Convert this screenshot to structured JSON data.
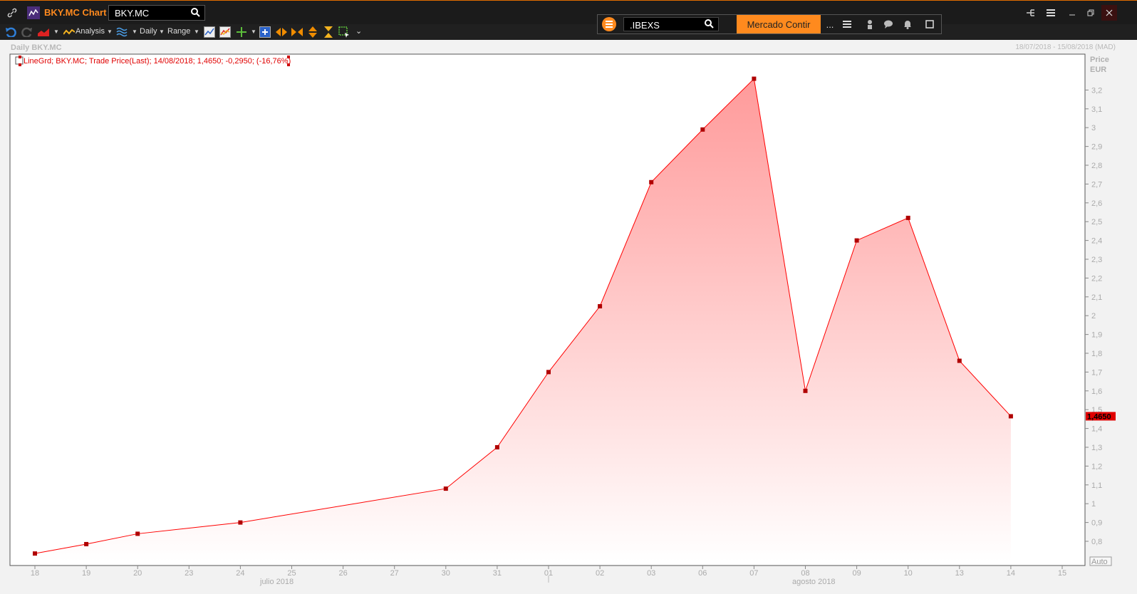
{
  "app": {
    "title": "BKY.MC Chart",
    "ric_value": "BKY.MC"
  },
  "float_panel": {
    "symbol_value": ".IBEXS",
    "mercado_label": "Mercado Contir",
    "more_label": "..."
  },
  "toolbar": {
    "analysis_label": "Analysis",
    "interval_label": "Daily",
    "range_label": "Range"
  },
  "chart_header": {
    "title": "Daily BKY.MC",
    "date_range": "18/07/2018 - 15/08/2018 (MAD)"
  },
  "legend": {
    "text": "LineGrd; BKY.MC; Trade Price(Last); 14/08/2018; 1,4650; -0,2950; (-16,76%)"
  },
  "axis": {
    "ylabel_line1": "Price",
    "ylabel_line2": "EUR",
    "auto_label": "Auto",
    "last_value_label": "1,4650",
    "month1_label": "julio 2018",
    "month2_label": "agosto 2018"
  },
  "colors": {
    "accent": "#ff8a1e",
    "series": "#ff0000",
    "marker": "#b00000"
  },
  "chart_data": {
    "type": "area",
    "x": [
      "18",
      "19",
      "20",
      "23",
      "24",
      "25",
      "26",
      "27",
      "30",
      "31",
      "01",
      "02",
      "03",
      "06",
      "07",
      "08",
      "09",
      "10",
      "13",
      "14",
      "15"
    ],
    "points": [
      {
        "x": "18",
        "y": 0.735
      },
      {
        "x": "19",
        "y": 0.785
      },
      {
        "x": "20",
        "y": 0.84
      },
      {
        "x": "24",
        "y": 0.9
      },
      {
        "x": "30",
        "y": 1.08
      },
      {
        "x": "31",
        "y": 1.3
      },
      {
        "x": "01",
        "y": 1.7
      },
      {
        "x": "02",
        "y": 2.05
      },
      {
        "x": "03",
        "y": 2.71
      },
      {
        "x": "06",
        "y": 2.99
      },
      {
        "x": "07",
        "y": 3.26
      },
      {
        "x": "08",
        "y": 1.6
      },
      {
        "x": "09",
        "y": 2.4
      },
      {
        "x": "10",
        "y": 2.52
      },
      {
        "x": "13",
        "y": 1.76
      },
      {
        "x": "14",
        "y": 1.465
      }
    ],
    "yticks": [
      "0,8",
      "0,9",
      "1",
      "1,1",
      "1,2",
      "1,3",
      "1,4",
      "1,5",
      "1,6",
      "1,7",
      "1,8",
      "1,9",
      "2",
      "2,1",
      "2,2",
      "2,3",
      "2,4",
      "2,5",
      "2,6",
      "2,7",
      "2,8",
      "2,9",
      "3",
      "3,1",
      "3,2"
    ],
    "ylim": [
      0.7,
      3.3
    ],
    "last_value": 1.465,
    "grid": false,
    "legend": "top-left"
  }
}
